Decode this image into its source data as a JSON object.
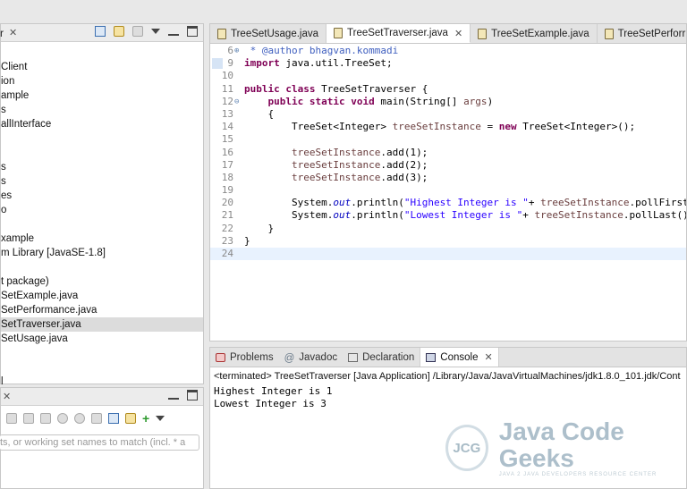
{
  "package_explorer": {
    "title": "r",
    "close": "✕",
    "items": [
      {
        "label": "Client",
        "selected": false
      },
      {
        "label": "ion",
        "selected": false
      },
      {
        "label": "ample",
        "selected": false
      },
      {
        "label": "s",
        "selected": false
      },
      {
        "label": "allInterface",
        "selected": false
      },
      {
        "label": "",
        "selected": false
      },
      {
        "label": "",
        "selected": false
      },
      {
        "label": "s",
        "selected": false
      },
      {
        "label": "s",
        "selected": false
      },
      {
        "label": "es",
        "selected": false
      },
      {
        "label": "o",
        "selected": false
      },
      {
        "label": "",
        "selected": false
      },
      {
        "label": "xample",
        "selected": false
      },
      {
        "label": "m Library [JavaSE-1.8]",
        "selected": false
      },
      {
        "label": "",
        "selected": false
      },
      {
        "label": "t package)",
        "selected": false
      },
      {
        "label": "SetExample.java",
        "selected": false
      },
      {
        "label": "SetPerformance.java",
        "selected": false
      },
      {
        "label": "SetTraverser.java",
        "selected": true
      },
      {
        "label": "SetUsage.java",
        "selected": false
      },
      {
        "label": "",
        "selected": false
      },
      {
        "label": "",
        "selected": false
      },
      {
        "label": "l",
        "selected": false
      }
    ]
  },
  "working_sets": {
    "filter_placeholder": "ts, or working set names to match (incl. * a"
  },
  "editor": {
    "tabs": [
      {
        "label": "TreeSetUsage.java",
        "active": false,
        "closable": false
      },
      {
        "label": "TreeSetTraverser.java",
        "active": true,
        "closable": true,
        "close": "✕"
      },
      {
        "label": "TreeSetExample.java",
        "active": false,
        "closable": false
      },
      {
        "label": "TreeSetPerforr",
        "active": false,
        "closable": false
      }
    ],
    "lines": [
      {
        "num": "6",
        "fold": "⊕",
        "html": "<span class=\"cmt\"> * @author bhagvan.kommadi</span>"
      },
      {
        "num": "9",
        "fold": "",
        "html": "<span class=\"kw\">import</span> java.util.TreeSet;"
      },
      {
        "num": "10",
        "fold": "",
        "html": ""
      },
      {
        "num": "11",
        "fold": "",
        "html": "<span class=\"kw\">public class</span> TreeSetTraverser {"
      },
      {
        "num": "12",
        "fold": "⊖",
        "html": "    <span class=\"kw\">public static void</span> main(String[] <span class=\"var\">args</span>)"
      },
      {
        "num": "13",
        "fold": "",
        "html": "    {"
      },
      {
        "num": "14",
        "fold": "",
        "html": "        TreeSet&lt;Integer&gt; <span class=\"var\">treeSetInstance</span> = <span class=\"kw\">new</span> TreeSet&lt;Integer&gt;();"
      },
      {
        "num": "15",
        "fold": "",
        "html": ""
      },
      {
        "num": "16",
        "fold": "",
        "html": "        <span class=\"var\">treeSetInstance</span>.add(1);"
      },
      {
        "num": "17",
        "fold": "",
        "html": "        <span class=\"var\">treeSetInstance</span>.add(2);"
      },
      {
        "num": "18",
        "fold": "",
        "html": "        <span class=\"var\">treeSetInstance</span>.add(3);"
      },
      {
        "num": "19",
        "fold": "",
        "html": ""
      },
      {
        "num": "20",
        "fold": "",
        "html": "        System.<span class=\"fld\">out</span>.println(<span class=\"str\">\"Highest Integer is \"</span>+ <span class=\"var\">treeSetInstance</span>.pollFirst());"
      },
      {
        "num": "21",
        "fold": "",
        "html": "        System.<span class=\"fld\">out</span>.println(<span class=\"str\">\"Lowest Integer is \"</span>+ <span class=\"var\">treeSetInstance</span>.pollLast());"
      },
      {
        "num": "22",
        "fold": "",
        "html": "    }"
      },
      {
        "num": "23",
        "fold": "",
        "html": "}"
      },
      {
        "num": "24",
        "fold": "",
        "html": ""
      }
    ]
  },
  "console": {
    "tabs": [
      {
        "label": "Problems",
        "active": false,
        "icon": "problems-icon"
      },
      {
        "label": "Javadoc",
        "active": false,
        "icon": "javadoc-icon",
        "glyph": "@"
      },
      {
        "label": "Declaration",
        "active": false,
        "icon": "declaration-icon"
      },
      {
        "label": "Console",
        "active": true,
        "icon": "console-icon",
        "close": "✕"
      }
    ],
    "terminated": "<terminated> TreeSetTraverser [Java Application] /Library/Java/JavaVirtualMachines/jdk1.8.0_101.jdk/Cont",
    "output": [
      "Highest Integer is 1",
      "Lowest Integer is 3"
    ]
  },
  "watermark": {
    "circle": "JCG",
    "title": "Java Code Geeks",
    "subtitle": "JAVA 2 JAVA DEVELOPERS RESOURCE CENTER"
  }
}
